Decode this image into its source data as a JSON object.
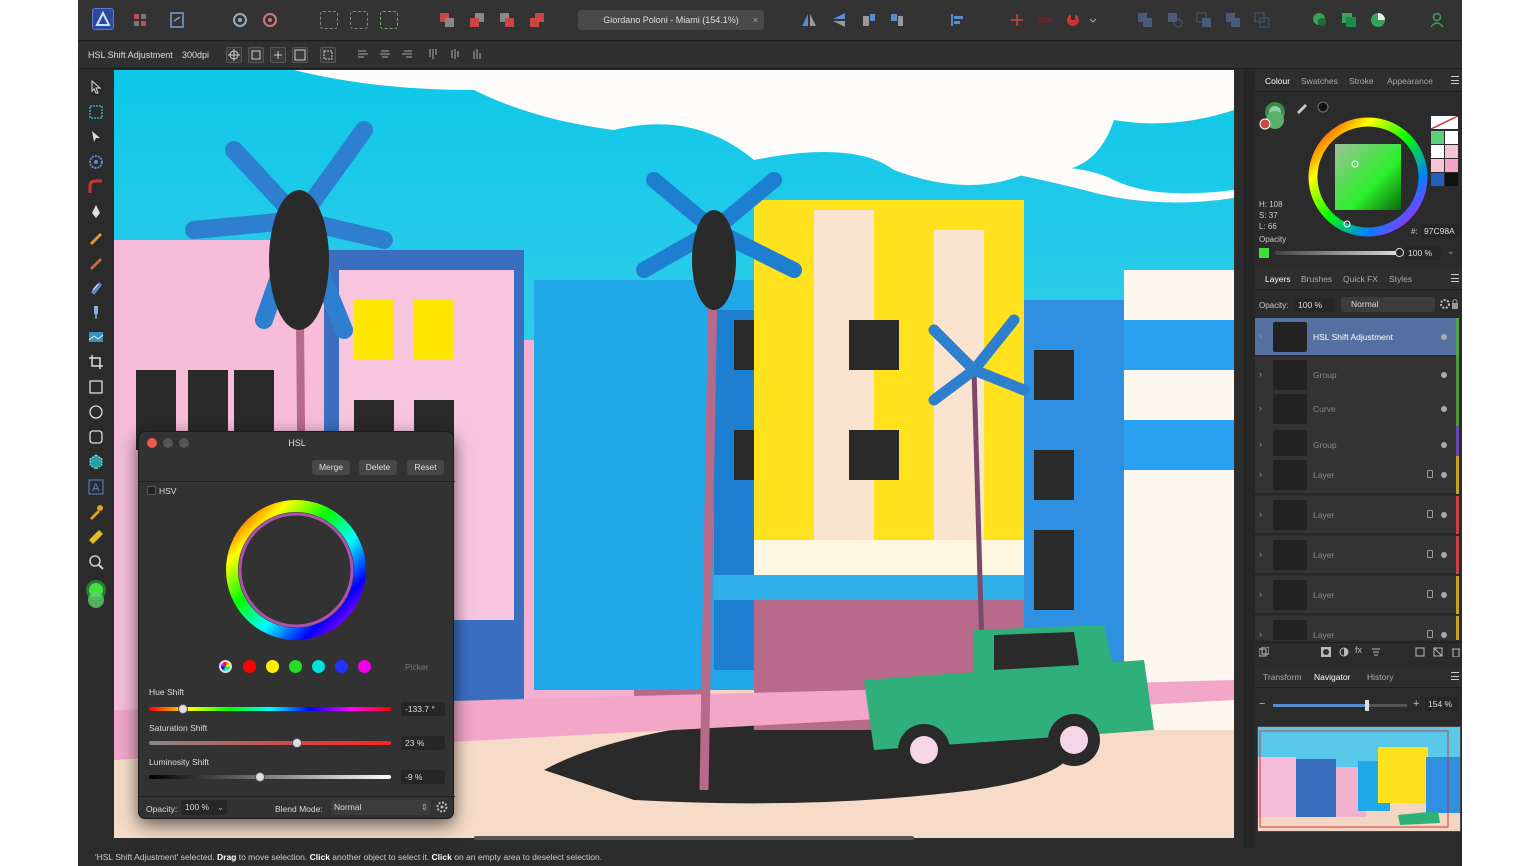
{
  "document_title": "Giordano Poloni - Miami (154.1%)",
  "close_glyph": "×",
  "context_bar": {
    "tool_label": "HSL Shift Adjustment",
    "dpi": "300dpi"
  },
  "colour_panel": {
    "tabs": [
      "Colour",
      "Swatches",
      "Stroke",
      "Appearance"
    ],
    "h": "H: 108",
    "s": "S: 37",
    "l": "L: 66",
    "hex_label": "#:",
    "hex": "97C98A",
    "opacity_label": "Opacity",
    "opacity": "100 %",
    "current_color": "#3fe03a"
  },
  "layers_panel": {
    "tabs": [
      "Layers",
      "Brushes",
      "Quick FX",
      "Styles"
    ],
    "opacity_label": "Opacity:",
    "opacity": "100 %",
    "blend": "Normal",
    "layers": [
      {
        "name": "HSL Shift Adjustment",
        "color": "#5aa04a",
        "selected": true
      },
      {
        "name": "Group",
        "color": "#4a9a3a"
      },
      {
        "name": "Curve",
        "color": "#4a9a3a"
      },
      {
        "name": "Group",
        "color": "#6a4ab0"
      },
      {
        "name": "Layer",
        "color": "#c8a020"
      },
      {
        "name": "Layer",
        "color": "#c84040"
      },
      {
        "name": "Layer",
        "color": "#c84040"
      },
      {
        "name": "Layer",
        "color": "#c8a020"
      },
      {
        "name": "Layer",
        "color": "#c8a020"
      }
    ]
  },
  "navigator_panel": {
    "tabs": [
      "Transform",
      "Navigator",
      "History"
    ],
    "zoom": "154 %",
    "minus": "−",
    "plus": "+"
  },
  "hsl_dialog": {
    "title": "HSL",
    "merge": "Merge",
    "delete": "Delete",
    "reset": "Reset",
    "hsv_label": "HSV",
    "picker": "Picker",
    "hue_label": "Hue Shift",
    "hue_value": "-133.7 °",
    "hue_fraction": 0.14,
    "sat_label": "Saturation Shift",
    "sat_value": "23 %",
    "sat_fraction": 0.61,
    "lum_label": "Luminosity Shift",
    "lum_value": "-9 %",
    "lum_fraction": 0.46,
    "opacity_label": "Opacity:",
    "opacity": "100 %",
    "blend_label": "Blend Mode:",
    "blend": "Normal",
    "swatches": [
      "#ffffff",
      "#ff0000",
      "#ffee00",
      "#22dd22",
      "#00e0e0",
      "#2233ff",
      "#ee00ee"
    ]
  },
  "status": {
    "p1": "'HSL Shift Adjustment' selected. ",
    "b1": "Drag",
    "p2": " to move selection. ",
    "b2": "Click",
    "p3": " another object to select it. ",
    "b3": "Click",
    "p4": " on an empty area to deselect selection."
  }
}
